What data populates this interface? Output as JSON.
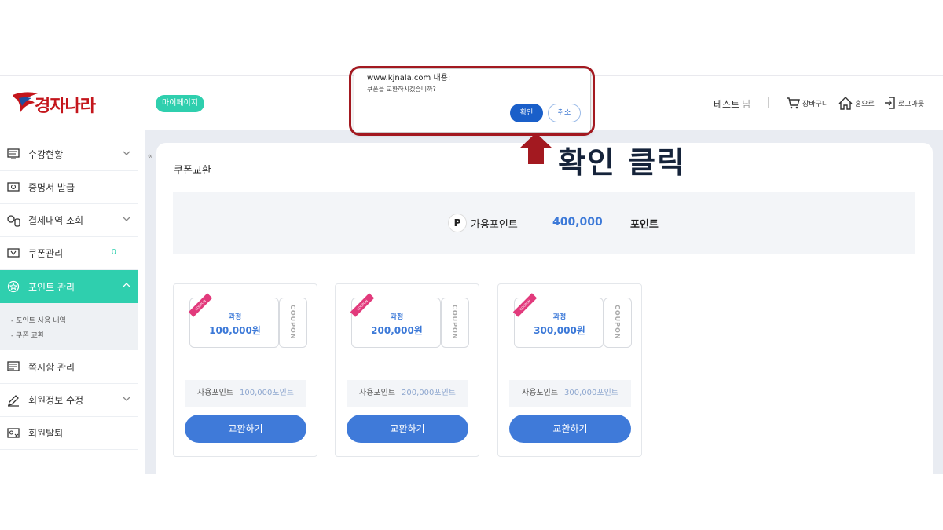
{
  "header": {
    "logo_text": "경자나라",
    "mypage_label": "마이페이지",
    "user_name": "테스트",
    "user_suffix": "님",
    "cart_label": "장바구니",
    "home_label": "홈으로",
    "logout_label": "로그아웃"
  },
  "sidebar": {
    "items": [
      {
        "label": "수강현황",
        "icon": "monitor-icon",
        "has_chevron": true
      },
      {
        "label": "증명서 발급",
        "icon": "certificate-icon",
        "has_chevron": false
      },
      {
        "label": "결제내역 조회",
        "icon": "payment-icon",
        "has_chevron": true
      },
      {
        "label": "쿠폰관리",
        "icon": "coupon-icon",
        "count": "0"
      },
      {
        "label": "포인트 관리",
        "icon": "point-icon",
        "active": true
      },
      {
        "label": "쪽지함 관리",
        "icon": "message-icon"
      },
      {
        "label": "회원정보 수정",
        "icon": "edit-icon",
        "has_chevron": true
      },
      {
        "label": "회원탈퇴",
        "icon": "withdraw-icon"
      }
    ],
    "sub_items": [
      "- 포인트 사용 내역",
      "- 쿠폰 교환"
    ],
    "collapse_label": "«"
  },
  "main": {
    "title": "쿠폰교환",
    "points_icon": "P",
    "points_label": "가용포인트",
    "points_amount": "400,000",
    "points_unit": "포인트",
    "coupons": [
      {
        "ribbon": "COUPON",
        "course": "과정",
        "price": "100,000원",
        "stub": "COUPON",
        "use_label": "사용포인트",
        "use_value": "100,000포인트",
        "button": "교환하기"
      },
      {
        "ribbon": "COUPON",
        "course": "과정",
        "price": "200,000원",
        "stub": "COUPON",
        "use_label": "사용포인트",
        "use_value": "200,000포인트",
        "button": "교환하기"
      },
      {
        "ribbon": "COUPON",
        "course": "과정",
        "price": "300,000원",
        "stub": "COUPON",
        "use_label": "사용포인트",
        "use_value": "300,000포인트",
        "button": "교환하기"
      }
    ]
  },
  "dialog": {
    "title": "www.kjnala.com 내용:",
    "message": "쿠폰을 교환하시겠습니까?",
    "ok_label": "확인",
    "cancel_label": "취소"
  },
  "annotation": {
    "text": "확인 클릭",
    "color": "#a31920"
  },
  "colors": {
    "accent_teal": "#2fcfae",
    "button_blue": "#3f7ad9",
    "highlight_red": "#a31920"
  }
}
